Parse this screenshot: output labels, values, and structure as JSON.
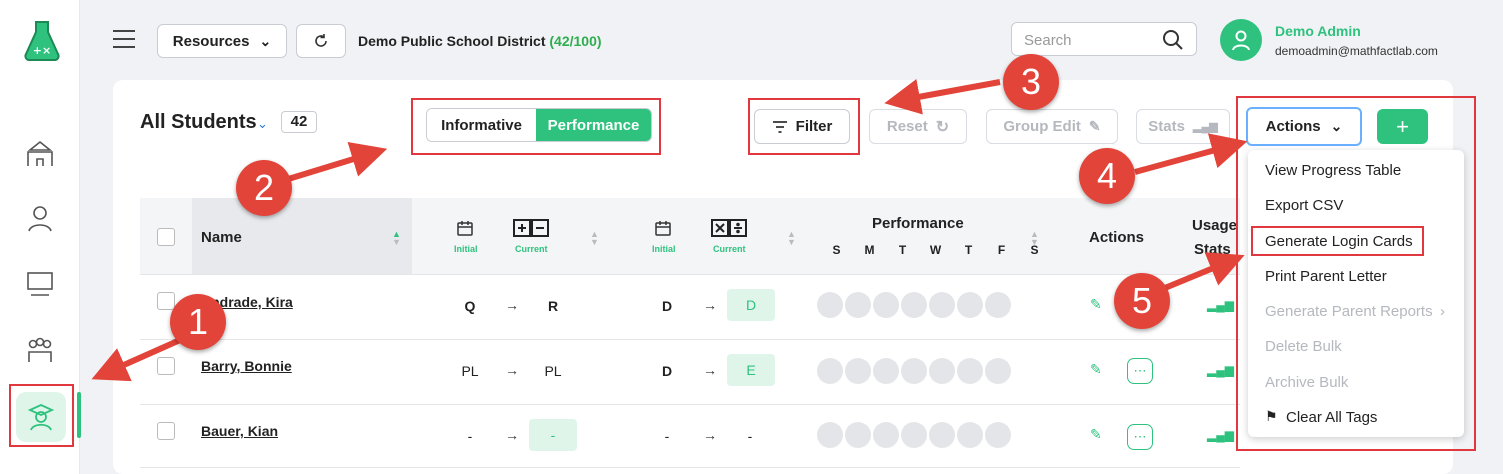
{
  "header": {
    "resources_label": "Resources",
    "district_name": "Demo Public School District",
    "district_count": "(42/100)",
    "search_placeholder": "Search",
    "user_name": "Demo Admin",
    "user_email": "demoadmin@mathfactlab.com"
  },
  "sidebar": {
    "icons": [
      "school-icon",
      "teacher-gear-icon",
      "classroom-icon",
      "group-icon",
      "student-icon"
    ]
  },
  "main": {
    "title": "All Students",
    "count": "42",
    "toggle": {
      "informative": "Informative",
      "performance": "Performance"
    },
    "filter_label": "Filter",
    "reset_label": "Reset",
    "group_edit_label": "Group Edit",
    "stats_label": "Stats",
    "actions_label": "Actions",
    "add_label": "+"
  },
  "table": {
    "col_name": "Name",
    "col_initial": "Initial",
    "col_current": "Current",
    "col_performance": "Performance",
    "days": [
      "S",
      "M",
      "T",
      "W",
      "T",
      "F",
      "S"
    ],
    "col_actions": "Actions",
    "col_usage": "Usage",
    "col_stats": "Stats",
    "rows": [
      {
        "name": "Andrade, Kira",
        "a_initial": "Q",
        "a_current": "R",
        "m_initial": "D",
        "m_current": "D"
      },
      {
        "name": "Barry, Bonnie",
        "a_initial": "PL",
        "a_current": "PL",
        "m_initial": "D",
        "m_current": "E"
      },
      {
        "name": "Bauer, Kian",
        "a_initial": "-",
        "a_current": "-",
        "m_initial": "-",
        "m_current": "-"
      }
    ]
  },
  "actions_menu": {
    "items": [
      "View Progress Table",
      "Export CSV",
      "Generate Login Cards",
      "Print Parent Letter",
      "Generate Parent Reports",
      "Delete Bulk",
      "Archive Bulk",
      "Clear All Tags"
    ]
  },
  "callouts": [
    "1",
    "2",
    "3",
    "4",
    "5"
  ],
  "colors": {
    "accent": "#2ec27e",
    "annotation": "#e0383e",
    "focus": "#6ab0ff"
  }
}
